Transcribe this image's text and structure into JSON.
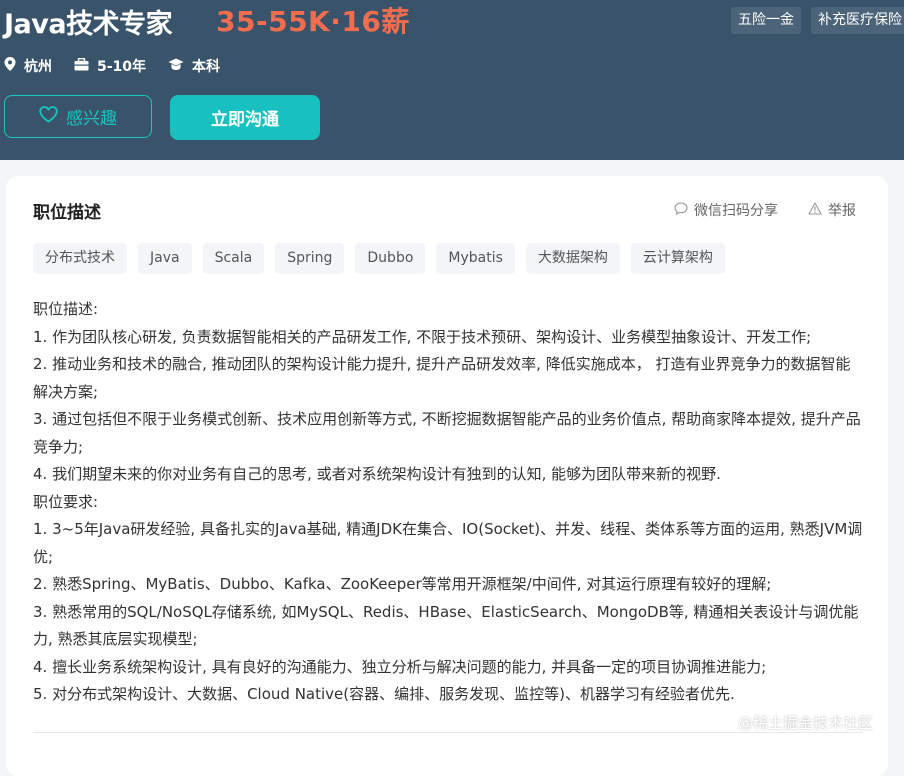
{
  "header": {
    "title": "Java技术专家",
    "salary": "35-55K·16薪",
    "benefits": [
      "五险一金",
      "补充医疗保险"
    ],
    "location": "杭州",
    "experience": "5-10年",
    "education": "本科",
    "interest_button": "感兴趣",
    "chat_button": "立即沟通"
  },
  "card": {
    "title": "职位描述",
    "share_label": "微信扫码分享",
    "report_label": "举报",
    "skills": [
      "分布式技术",
      "Java",
      "Scala",
      "Spring",
      "Dubbo",
      "Mybatis",
      "大数据架构",
      "云计算架构"
    ],
    "description": [
      "职位描述:",
      "1. 作为团队核心研发, 负责数据智能相关的产品研发工作, 不限于技术预研、架构设计、业务模型抽象设计、开发工作;",
      "2. 推动业务和技术的融合, 推动团队的架构设计能力提升, 提升产品研发效率, 降低实施成本， 打造有业界竞争力的数据智能解决方案;",
      "3. 通过包括但不限于业务模式创新、技术应用创新等方式, 不断挖掘数据智能产品的业务价值点, 帮助商家降本提效, 提升产品竞争力;",
      "4. 我们期望未来的你对业务有自己的思考, 或者对系统架构设计有独到的认知, 能够为团队带来新的视野.",
      "职位要求:",
      "1. 3~5年Java研发经验, 具备扎实的Java基础, 精通JDK在集合、IO(Socket)、并发、线程、类体系等方面的运用, 熟悉JVM调优;",
      "2. 熟悉Spring、MyBatis、Dubbo、Kafka、ZooKeeper等常用开源框架/中间件, 对其运行原理有较好的理解;",
      "3. 熟悉常用的SQL/NoSQL存储系统, 如MySQL、Redis、HBase、ElasticSearch、MongoDB等, 精通相关表设计与调优能力, 熟悉其底层实现模型;",
      "4. 擅长业务系统架构设计, 具有良好的沟通能力、独立分析与解决问题的能力, 并具备一定的项目协调推进能力;",
      "5. 对分布式架构设计、大数据、Cloud Native(容器、编排、服务发现、监控等)、机器学习有经验者优先."
    ]
  },
  "watermark": "@稀土掘金技术社区",
  "colors": {
    "header_bg": "#39546a",
    "salary": "#f26d4f",
    "accent": "#18c1bf",
    "card_bg": "#ffffff",
    "page_bg": "#f3f5f8"
  },
  "icons": {
    "location": "location-pin-icon",
    "experience": "briefcase-icon",
    "education": "graduation-cap-icon",
    "interest": "heart-icon",
    "share": "chat-bubble-icon",
    "report": "warning-icon"
  }
}
